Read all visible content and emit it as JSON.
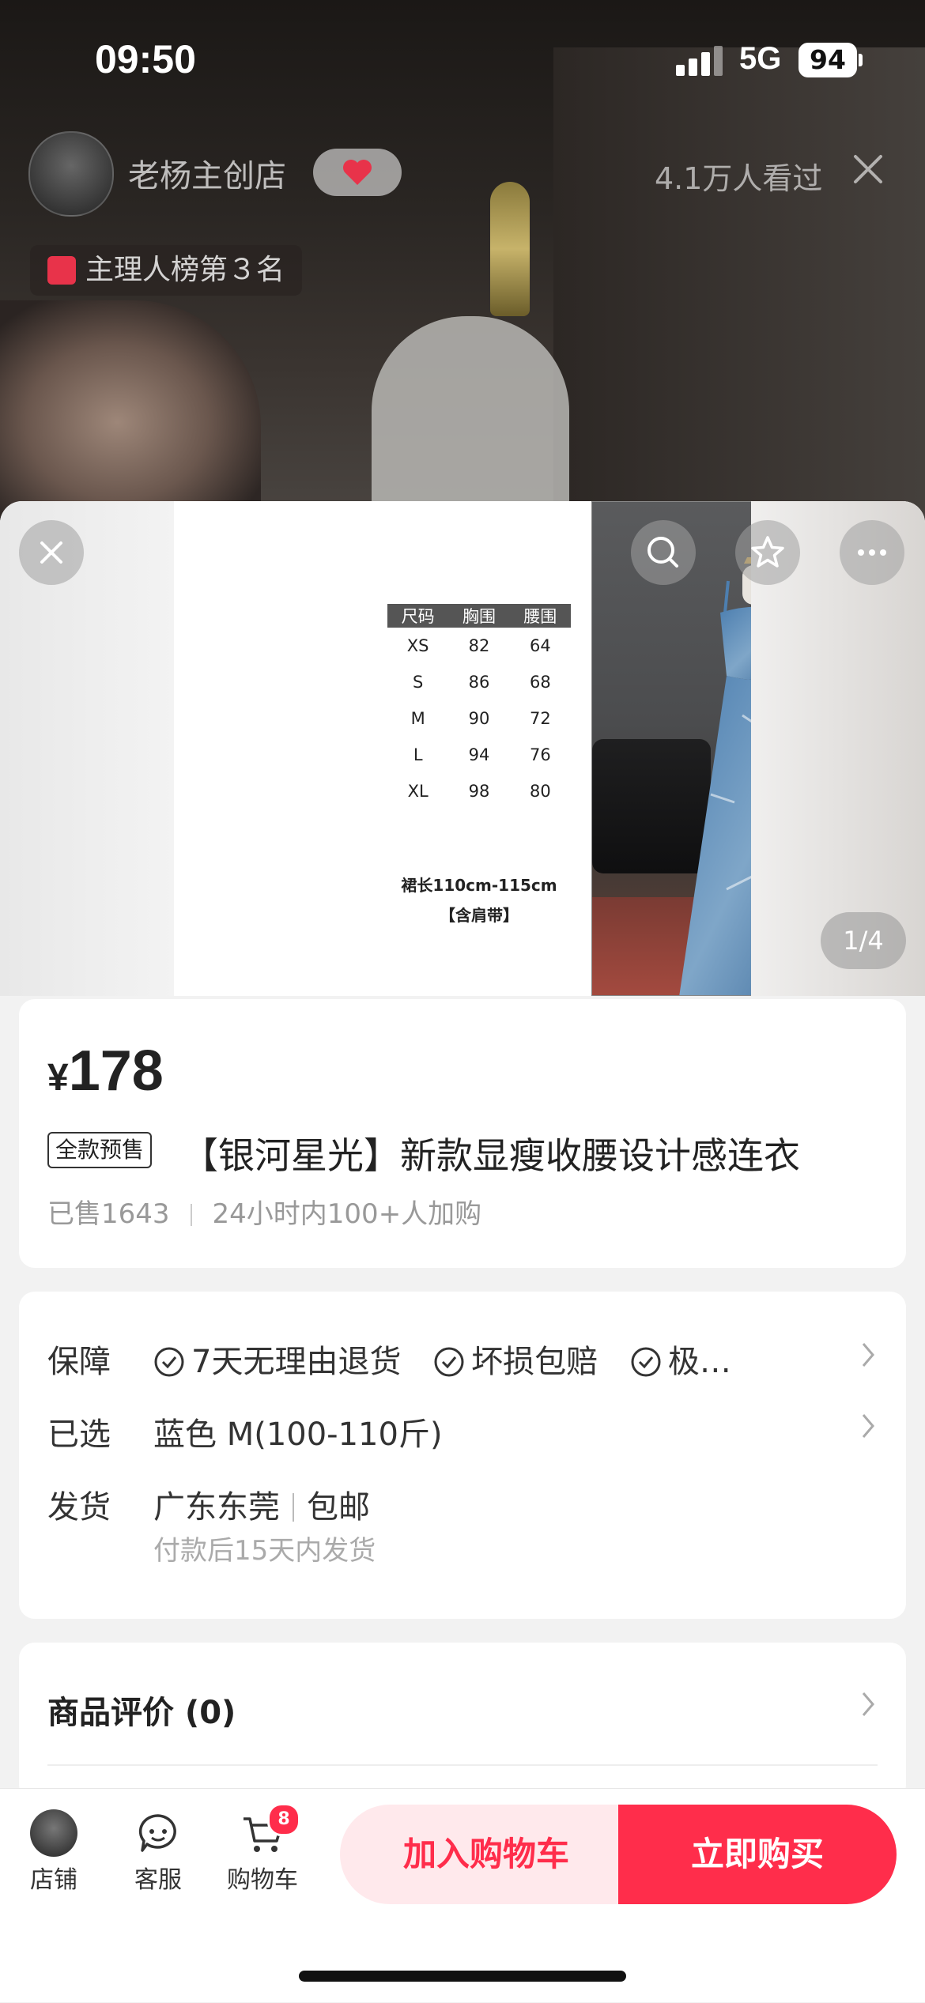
{
  "status_bar": {
    "time": "09:50",
    "network": "5G",
    "battery": "94"
  },
  "live": {
    "store_name": "老杨主创店",
    "viewers": "4.1万人看过",
    "rank": "主理人榜第３名"
  },
  "gallery": {
    "page_indicator": "1/4",
    "size_table": {
      "headers": [
        "尺码",
        "胸围",
        "腰围"
      ],
      "rows": [
        [
          "XS",
          "82",
          "64"
        ],
        [
          "S",
          "86",
          "68"
        ],
        [
          "M",
          "90",
          "72"
        ],
        [
          "L",
          "94",
          "76"
        ],
        [
          "XL",
          "98",
          "80"
        ]
      ],
      "note_length": "裙长110cm-115cm",
      "note_strap": "【含肩带】"
    }
  },
  "product": {
    "currency": "¥",
    "price": "178",
    "presale_tag": "全款预售",
    "title": "【银河星光】新款显瘦收腰设计感连衣",
    "sold": "已售1643",
    "recent": "24小时内100+人加购"
  },
  "info": {
    "guarantee_label": "保障",
    "guarantees": [
      "7天无理由退货",
      "坏损包赔",
      "极…"
    ],
    "selected_label": "已选",
    "selected_value": "蓝色 M(100-110斤)",
    "ship_label": "发货",
    "ship_from": "广东东莞",
    "ship_fee": "包邮",
    "ship_time": "付款后15天内发货"
  },
  "reviews": {
    "title": "商品评价 (0)"
  },
  "bottom_bar": {
    "store": "店铺",
    "service": "客服",
    "cart": "购物车",
    "cart_count": "8",
    "add_to_cart": "加入购物车",
    "buy_now": "立即购买"
  },
  "colors": {
    "accent": "#ff2d4b",
    "accent_light": "#ffe9ec"
  }
}
